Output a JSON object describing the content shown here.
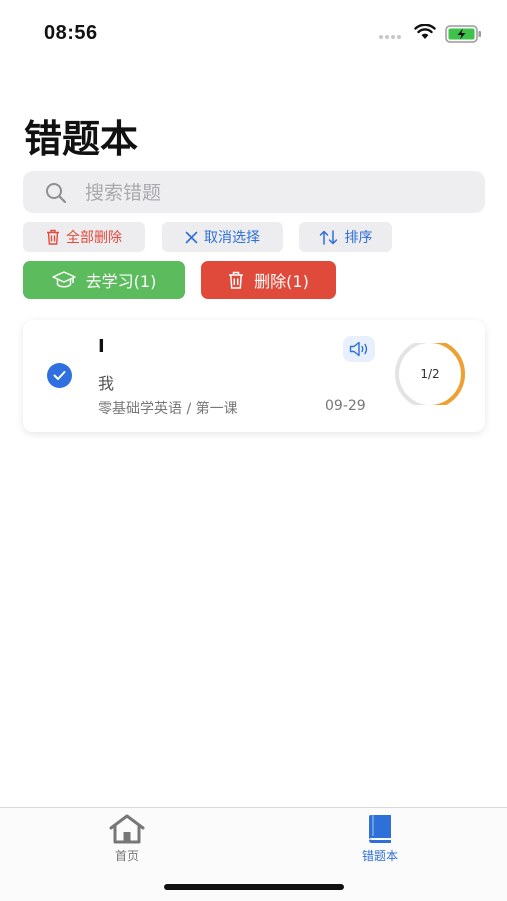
{
  "status_bar": {
    "time": "08:56"
  },
  "page": {
    "title": "错题本"
  },
  "search": {
    "placeholder": "搜索错题"
  },
  "toolbar": {
    "delete_all_label": "全部删除",
    "cancel_select_label": "取消选择",
    "sort_label": "排序"
  },
  "actions": {
    "study_label": "去学习(1)",
    "delete_label": "删除(1)"
  },
  "items": [
    {
      "word": "I",
      "meaning": "我",
      "source": "零基础学英语 / 第一课",
      "date": "09-29",
      "progress_text": "1/2",
      "progress_fraction": 0.5,
      "selected": true
    }
  ],
  "tab_bar": {
    "home_label": "首页",
    "notebook_label": "错题本",
    "active": "notebook"
  },
  "colors": {
    "accent": "#2f6fd8",
    "green": "#5cbb5c",
    "red": "#e04a3b",
    "progress": "#f0a030"
  },
  "icons": [
    "search-icon",
    "trash-icon",
    "close-icon",
    "sort-icon",
    "graduation-cap-icon",
    "speaker-icon",
    "check-icon",
    "home-icon",
    "book-icon",
    "wifi-icon",
    "battery-icon"
  ]
}
